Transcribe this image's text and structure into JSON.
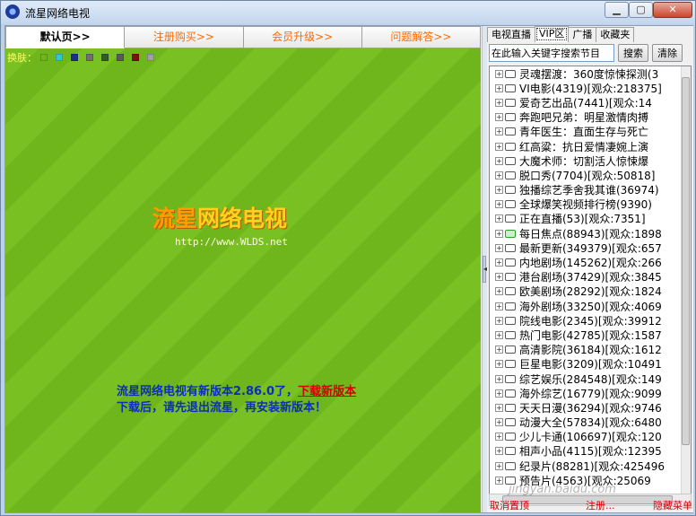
{
  "window": {
    "title": "流星网络电视"
  },
  "nav": {
    "tabs": [
      "默认页>>",
      "注册购买>>",
      "会员升级>>",
      "问题解答>>"
    ]
  },
  "skin": {
    "label": "换肤：",
    "colors": [
      "#6fb61c",
      "#33c7c7",
      "#1a2f8a",
      "#707070",
      "#355a2a",
      "#5a5a5a",
      "#7a1010",
      "#a0a0a0"
    ]
  },
  "logo": {
    "text_main": "流星",
    "text_rest": "网络电视",
    "url": "http://www.WLDS.net"
  },
  "notice": {
    "line1": "流星网络电视有新版本2.86.0了，",
    "link": "下载新版本",
    "line2": "下载后，请先退出流星，再安装新版本！"
  },
  "right": {
    "tabs": [
      "电视直播",
      "VIP区",
      "广播",
      "收藏夹"
    ],
    "search_placeholder": "在此输入关键字搜索节目",
    "search_button": "搜索",
    "clear_button": "清除",
    "items": [
      "灵魂摆渡：360度惊悚探测(3",
      "VI电影(4319)[观众:218375]",
      "爱奇艺出品(7441)[观众:14",
      "奔跑吧兄弟：明星激情肉搏",
      "青年医生：直面生存与死亡",
      "红高粱：抗日爱情凄婉上演",
      "大魔术师：切割活人惊悚爆",
      "脱口秀(7704)[观众:50818]",
      "独播综艺季舍我其谁(36974)",
      "全球爆笑视频排行榜(9390)",
      "正在直播(53)[观众:7351]",
      "每日焦点(88943)[观众:1898",
      "最新更新(349379)[观众:657",
      "内地剧场(145262)[观众:266",
      "港台剧场(37429)[观众:3845",
      "欧美剧场(28292)[观众:1824",
      "海外剧场(33250)[观众:4069",
      "院线电影(2345)[观众:39912",
      "热门电影(42785)[观众:1587",
      "高清影院(36184)[观众:1612",
      "巨星电影(3209)[观众:10491",
      "综艺娱乐(284548)[观众:149",
      "海外综艺(16779)[观众:9099",
      "天天日漫(36294)[观众:9746",
      "动漫大全(57834)[观众:6480",
      "少儿卡通(106697)[观众:120",
      "相声小品(4115)[观众:12395",
      "纪录片(88281)[观众:425496",
      "预告片(4563)[观众:25069"
    ],
    "footer_left": "取消置顶",
    "footer_mid": "注册...",
    "footer_right": "隐藏菜单"
  },
  "watermark": "jingyan.baidu.com"
}
